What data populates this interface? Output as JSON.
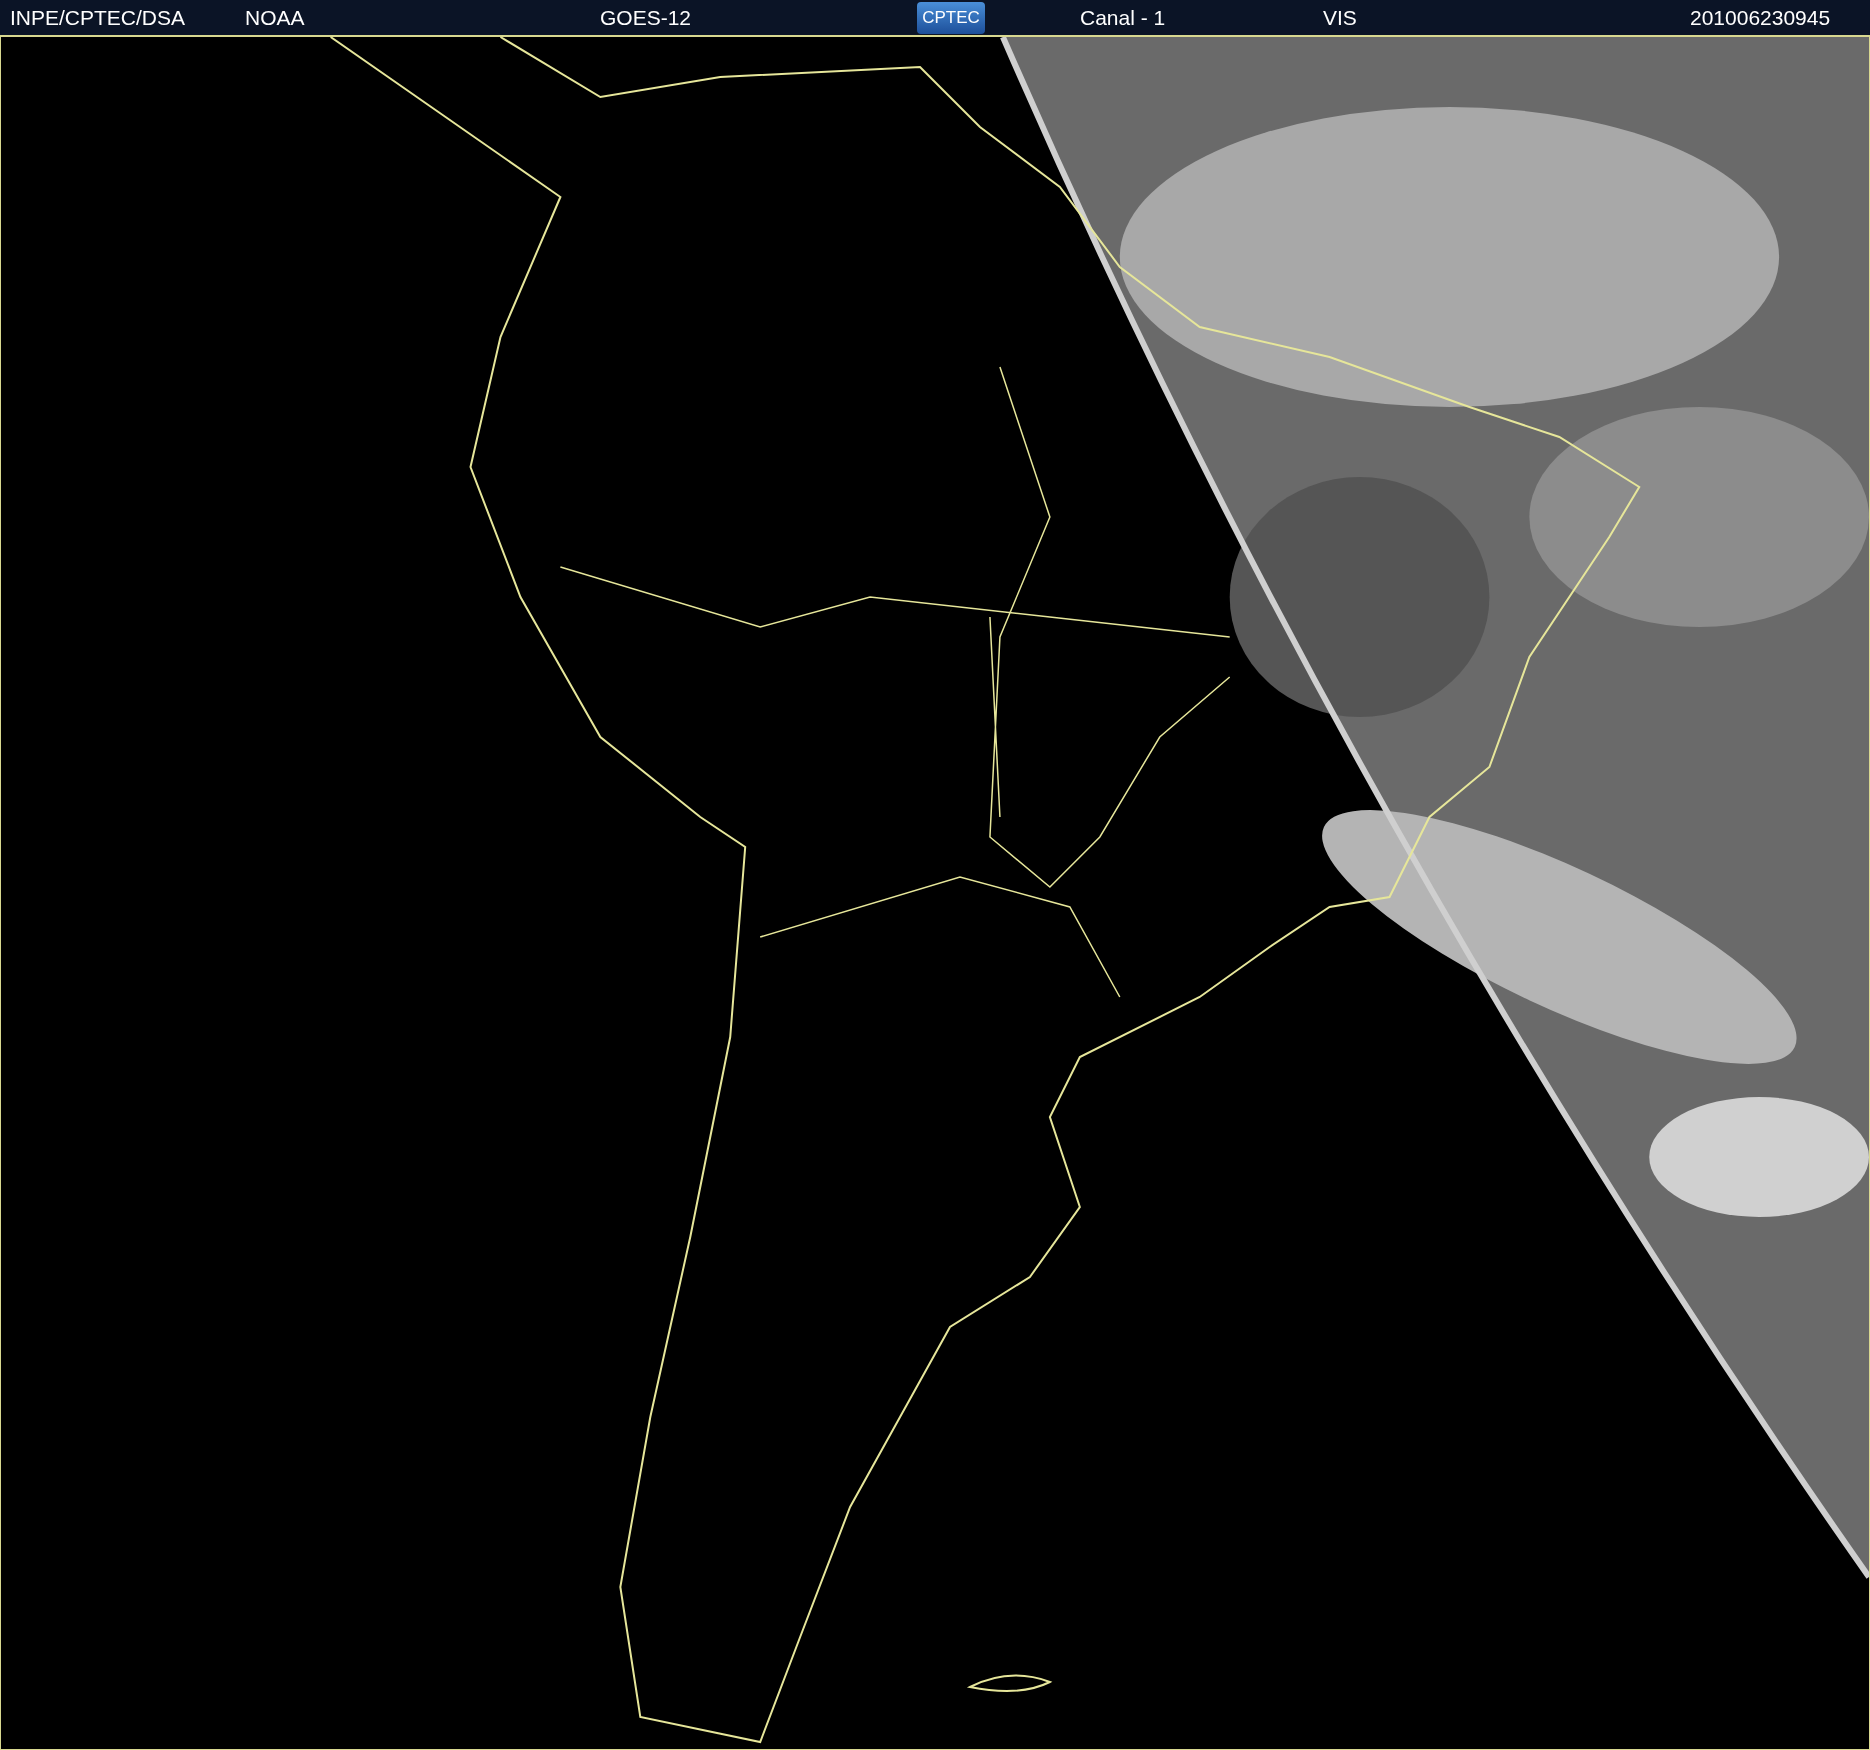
{
  "header": {
    "items": [
      {
        "kind": "text",
        "text": "INPE/CPTEC/DSA"
      },
      {
        "kind": "text",
        "text": "NOAA"
      },
      {
        "kind": "text",
        "text": "GOES-12"
      },
      {
        "kind": "logo",
        "text": "CPTEC"
      },
      {
        "kind": "text",
        "text": "Canal - 1"
      },
      {
        "kind": "text",
        "text": "VIS"
      },
      {
        "kind": "text",
        "text": "201006230945"
      }
    ]
  }
}
